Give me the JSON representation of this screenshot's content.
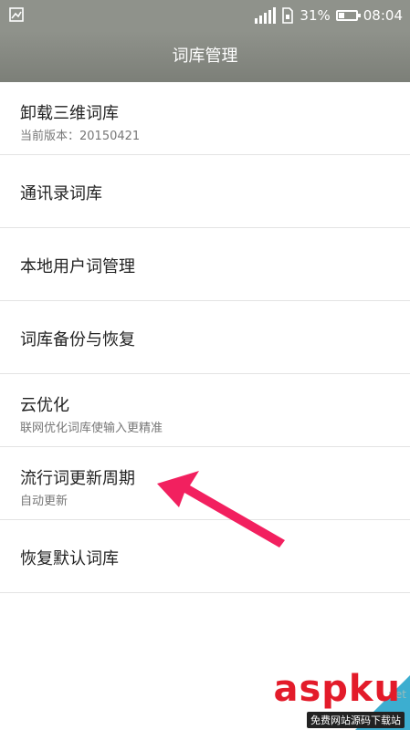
{
  "status": {
    "battery_text": "31%",
    "time": "08:04",
    "battery_level": 0.31
  },
  "header": {
    "title": "词库管理"
  },
  "items": [
    {
      "title": "卸载三维词库",
      "subtitle": "当前版本：20150421"
    },
    {
      "title": "通讯录词库",
      "subtitle": ""
    },
    {
      "title": "本地用户词管理",
      "subtitle": ""
    },
    {
      "title": "词库备份与恢复",
      "subtitle": ""
    },
    {
      "title": "云优化",
      "subtitle": "联网优化词库使输入更精准"
    },
    {
      "title": "流行词更新周期",
      "subtitle": "自动更新"
    },
    {
      "title": "恢复默认词库",
      "subtitle": ""
    }
  ],
  "watermark": {
    "logo": "aspku",
    "net": ".net",
    "sub": "免费网站源码下载站"
  },
  "colors": {
    "arrow": "#f2205f",
    "header": "#8f928b",
    "watermark": "#e31b2a"
  }
}
